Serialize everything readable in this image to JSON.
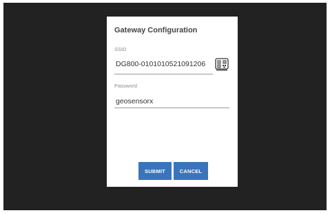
{
  "dialog": {
    "title": "Gateway Configuration",
    "ssid": {
      "label": "SSID",
      "value": "DG800-0101010521091206",
      "scan_icon": "qr-code-scan-icon"
    },
    "password": {
      "label": "Password",
      "value": "geosensorx"
    },
    "buttons": {
      "submit": "SUBMIT",
      "cancel": "CANCEL"
    }
  },
  "colors": {
    "backdrop": "#222222",
    "dialog_background": "#ffffff",
    "button": "#3a75bb",
    "title_text": "#444444",
    "label_text": "#8a8a8a"
  }
}
